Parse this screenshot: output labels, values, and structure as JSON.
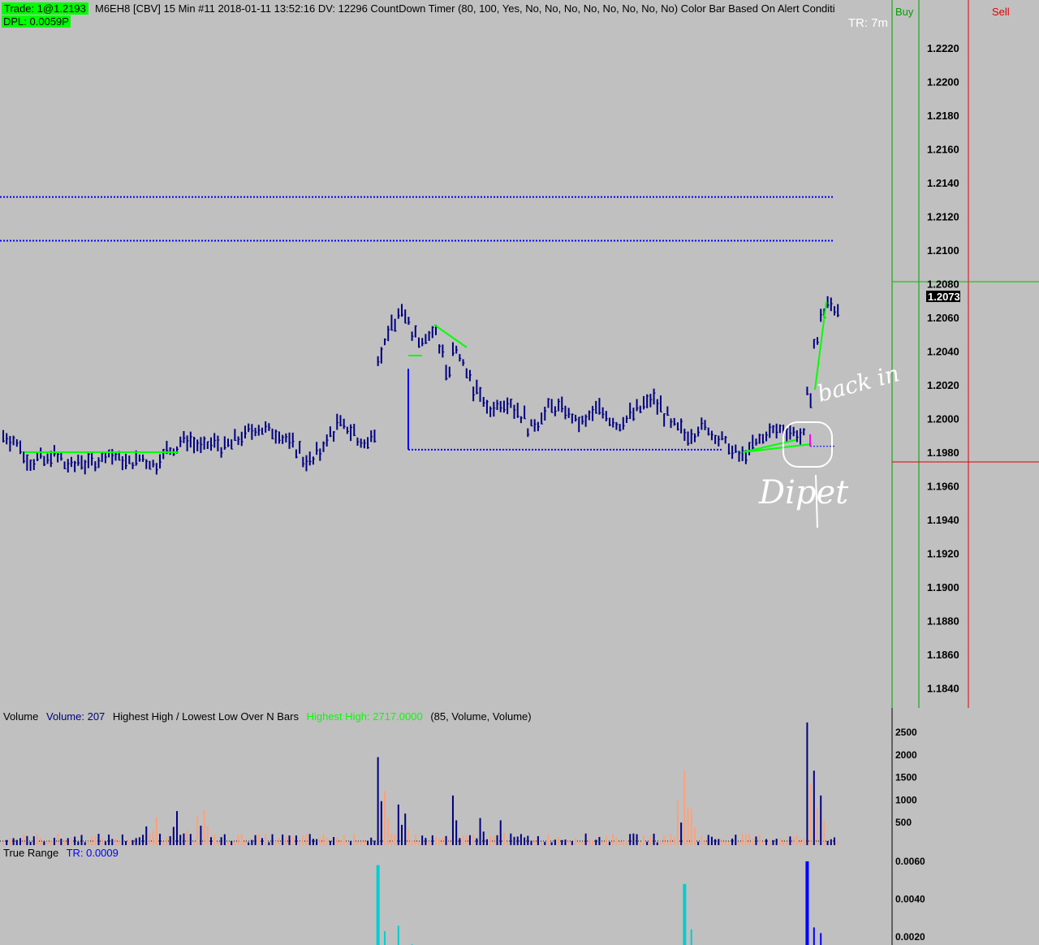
{
  "header": {
    "trade_badge": "Trade: 1@1.2193",
    "dpl_badge": "DPL: 0.0059P",
    "title": "M6EH8 [CBV]  15 Min   #11 2018-01-11 13:52:16 DV: 12296  CountDown Timer   (80, 100, Yes, No, No, No, No, No, No, No, No)  Color Bar Based On Alert Conditi",
    "timer": "TR: 7m"
  },
  "dom_panel": {
    "buy_label": "Buy",
    "sell_label": "Sell"
  },
  "colors": {
    "background": "#c0c0c0",
    "bars": "#000080",
    "trend_line": "#00ff00",
    "level_line": "#0000ff",
    "volume_up": "#000080",
    "volume_down": "#ffa07a",
    "true_range": "#00ced1",
    "annotation": "#ffffff",
    "current_price_bg": "#000000"
  },
  "volume_pane": {
    "label": "Volume",
    "volume_text": "Volume: 207",
    "study": "Highest High / Lowest Low Over N Bars",
    "highest_high": "Highest High: 2717.0000",
    "params": "(85, Volume, Volume)"
  },
  "tr_pane": {
    "label": "True Range",
    "tr_text": "TR: 0.0009"
  },
  "annotations": [
    "back in",
    "Dipet"
  ],
  "chart_data": [
    {
      "type": "ohlc",
      "symbol": "M6EH8 [CBV]",
      "interval": "15 Min",
      "current_price_label": "1.2073",
      "y_ticks": [
        "1.2220",
        "1.2200",
        "1.2180",
        "1.2160",
        "1.2140",
        "1.2120",
        "1.2100",
        "1.2080",
        "1.2060",
        "1.2040",
        "1.2020",
        "1.2000",
        "1.1980",
        "1.1960",
        "1.1940",
        "1.1920",
        "1.1900",
        "1.1880",
        "1.1860",
        "1.1840"
      ],
      "ylim": [
        1.1828,
        1.2246
      ],
      "grid": false,
      "horizontal_levels": [
        1.2132,
        1.2106,
        1.1982
      ],
      "bars_anchor_y": [
        1.199,
        1.1988,
        1.1985,
        1.1977,
        1.1975,
        1.1977,
        1.1975,
        1.1979,
        1.1977,
        1.1973,
        1.1972,
        1.1976,
        1.1973,
        1.1975,
        1.1976,
        1.198,
        1.1978,
        1.1976,
        1.1974,
        1.1975,
        1.1977,
        1.1975,
        1.1973,
        1.1978,
        1.1982,
        1.1983,
        1.1987,
        1.1988,
        1.1985,
        1.1983,
        1.1985,
        1.1986,
        1.1983,
        1.1985,
        1.1988,
        1.199,
        1.1993,
        1.1995,
        1.1994,
        1.1993,
        1.1992,
        1.1989,
        1.1985,
        1.1982,
        1.1976,
        1.1975,
        1.198,
        1.1986,
        1.1992,
        1.1997,
        1.1995,
        1.1993,
        1.1987,
        1.1985,
        1.1993,
        1.2037,
        1.2048,
        1.2057,
        1.2062,
        1.206,
        1.2052,
        1.2048,
        1.205,
        1.2052,
        1.2042,
        1.2028,
        1.204,
        1.2035,
        1.2026,
        1.2018,
        1.2012,
        1.2005,
        1.2008,
        1.201,
        1.2011,
        1.2006,
        1.2002,
        1.1995,
        1.1998,
        1.2003,
        1.2007,
        1.2007,
        1.2006,
        1.2002,
        1.1998,
        1.1998,
        1.2002,
        1.2006,
        1.2004,
        1.2,
        1.1997,
        1.2,
        1.2003,
        1.2006,
        1.2009,
        1.2012,
        1.2008,
        1.2002,
        1.1996,
        1.1994,
        1.1991,
        1.1992,
        1.1995,
        1.1995,
        1.1991,
        1.1988,
        1.1985,
        1.198,
        1.1978,
        1.198,
        1.1985,
        1.1988,
        1.1992,
        1.1993,
        1.1994,
        1.1993,
        1.1992,
        1.199,
        1.2014,
        1.2045,
        1.2063,
        1.2068,
        1.2066
      ],
      "volume": {
        "y_ticks": [
          "2500",
          "2000",
          "1500",
          "1000",
          "500"
        ],
        "ylim": [
          0,
          2800
        ],
        "highest_high": 2717
      },
      "true_range": {
        "y_ticks": [
          "0.0060",
          "0.0040",
          "0.0020"
        ],
        "ylim": [
          0.0016,
          0.0065
        ]
      }
    }
  ]
}
